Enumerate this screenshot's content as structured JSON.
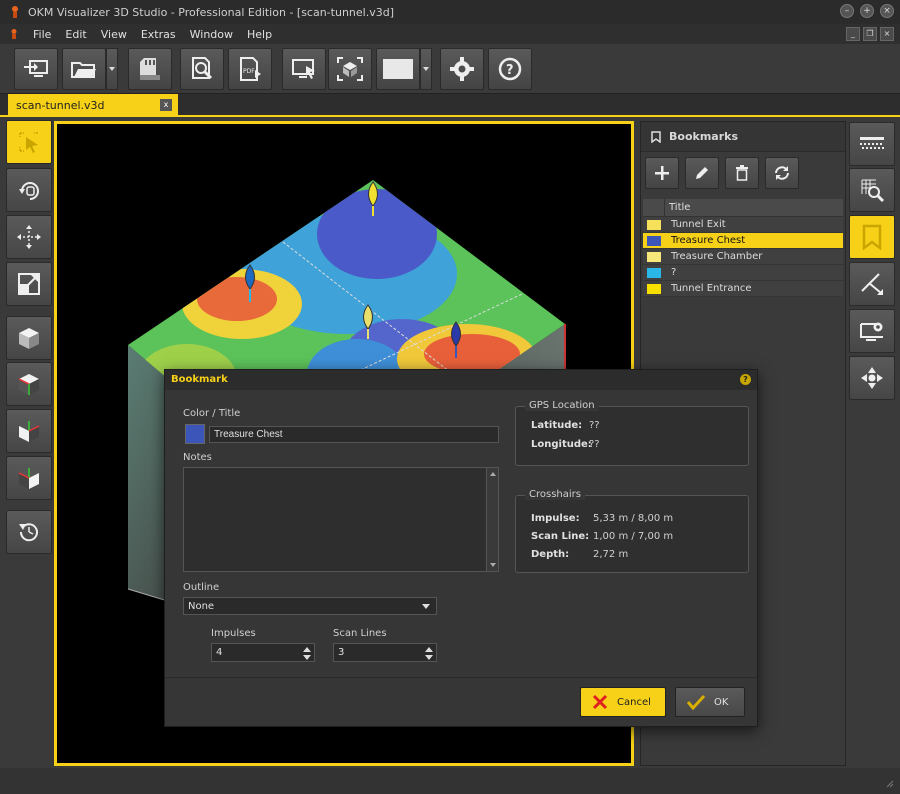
{
  "window": {
    "title": "OKM Visualizer 3D Studio - Professional Edition - [scan-tunnel.v3d]"
  },
  "menu": {
    "items": [
      "File",
      "Edit",
      "View",
      "Extras",
      "Window",
      "Help"
    ]
  },
  "toolbar": {
    "buttons": [
      "monitor-transfer-icon",
      "open-folder-icon",
      "sd-card-icon",
      "zoom-page-icon",
      "pdf-export-icon",
      "screen-select-icon",
      "cube-frame-icon",
      "color-rect-icon",
      "settings-icon",
      "help-icon"
    ]
  },
  "document_tab": {
    "label": "scan-tunnel.v3d",
    "close": "x"
  },
  "bookmarks_panel": {
    "title": "Bookmarks",
    "column_title": "Title",
    "rows": [
      {
        "title": "Tunnel Exit",
        "color": "#f5e25a",
        "selected": false
      },
      {
        "title": "Treasure Chest",
        "color": "#3b55b8",
        "selected": true
      },
      {
        "title": "Treasure Chamber",
        "color": "#f7e77a",
        "selected": false
      },
      {
        "title": "?",
        "color": "#2bb6e8",
        "selected": false
      },
      {
        "title": "Tunnel Entrance",
        "color": "#f7e000",
        "selected": false
      }
    ]
  },
  "dialog": {
    "title": "Bookmark",
    "help": "?",
    "color_title_label": "Color / Title",
    "title_value": "Treasure Chest",
    "notes_label": "Notes",
    "outline_label": "Outline",
    "outline_value": "None",
    "impulses_label": "Impulses",
    "impulses_value": "4",
    "scan_lines_label": "Scan Lines",
    "scan_lines_value": "3",
    "gps": {
      "group_title": "GPS Location",
      "latitude_label": "Latitude:",
      "latitude_value": "??",
      "longitude_label": "Longitude:",
      "longitude_value": "??"
    },
    "crosshairs": {
      "group_title": "Crosshairs",
      "impulse_label": "Impulse:",
      "impulse_value": "5,33 m / 8,00 m",
      "scan_line_label": "Scan Line:",
      "scan_line_value": "1,00 m / 7,00 m",
      "depth_label": "Depth:",
      "depth_value": "2,72 m"
    },
    "cancel_label": "Cancel",
    "ok_label": "OK"
  },
  "colors": {
    "accent": "#f7d117",
    "dark_bg": "#3a3a3a"
  }
}
